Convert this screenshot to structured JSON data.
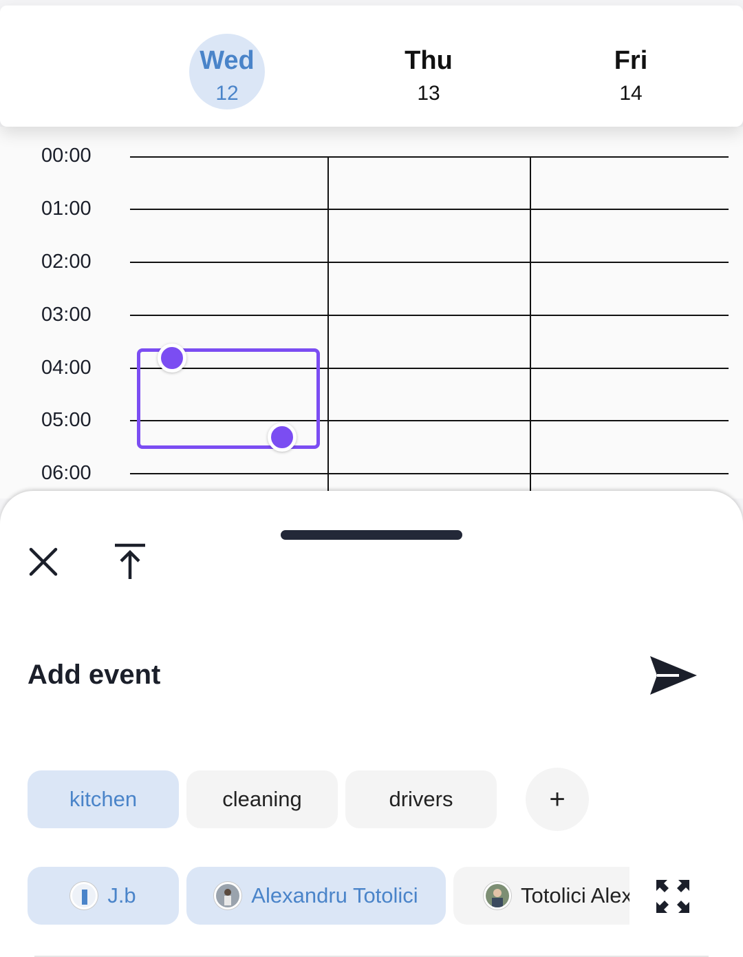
{
  "header": {
    "days": [
      {
        "name": "Wed",
        "num": "12",
        "selected": true
      },
      {
        "name": "Thu",
        "num": "13",
        "selected": false
      },
      {
        "name": "Fri",
        "num": "14",
        "selected": false
      }
    ]
  },
  "grid": {
    "hours": [
      "00:00",
      "01:00",
      "02:00",
      "03:00",
      "04:00",
      "05:00",
      "06:00"
    ]
  },
  "sheet": {
    "title": "Add event",
    "icons": {
      "close": "close-icon",
      "collapse": "arrow-to-top-icon",
      "send": "send-icon",
      "expand": "expand-icon"
    },
    "categories": [
      {
        "label": "kitchen",
        "selected": true
      },
      {
        "label": "cleaning",
        "selected": false
      },
      {
        "label": "drivers",
        "selected": false
      }
    ],
    "add_label": "+",
    "people": [
      {
        "label": "J.b",
        "selected": true
      },
      {
        "label": "Alexandru Totolici",
        "selected": true
      },
      {
        "label": "Totolici Alex",
        "selected": false
      }
    ]
  },
  "colors": {
    "accent": "#4a84c9",
    "accent_bg": "#dbe6f6",
    "selection": "#7b4df2",
    "dark": "#1b1f2a"
  }
}
